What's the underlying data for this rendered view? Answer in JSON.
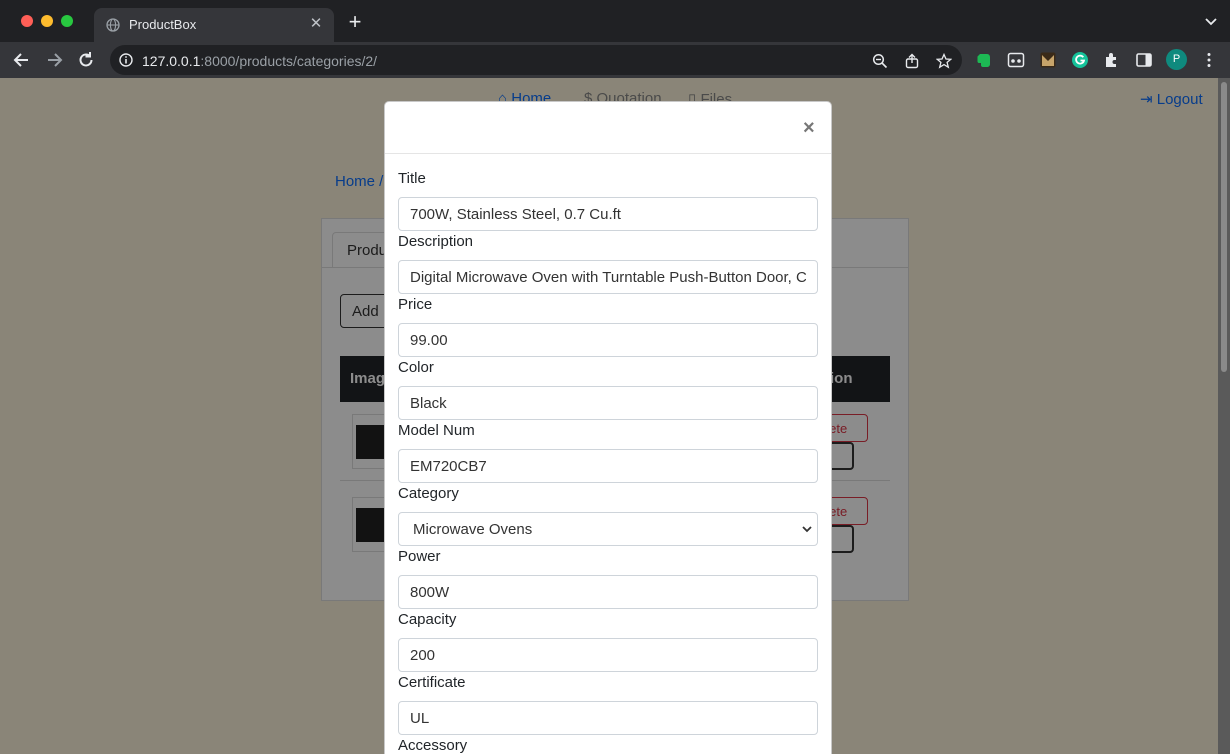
{
  "browser": {
    "tab_title": "ProductBox",
    "url_host": "127.0.0.1",
    "url_path": ":8000/products/categories/2/",
    "avatar_letter": "P"
  },
  "nav": {
    "home": "Home",
    "quotation": "Quotation",
    "files": "Files",
    "logout": "Logout"
  },
  "background": {
    "breadcrumb": "Home /",
    "tab_label": "Produ",
    "add_button": "Add I",
    "table_header_image": "Imag",
    "table_header_action": "tion",
    "delete_label": "elete",
    "edit_label": "dit"
  },
  "modal": {
    "close": "×",
    "fields": {
      "title": {
        "label": "Title",
        "value": "700W, Stainless Steel, 0.7 Cu.ft"
      },
      "description": {
        "label": "Description",
        "value": "Digital Microwave Oven with Turntable Push-Button Door, Child Safety Lock"
      },
      "price": {
        "label": "Price",
        "value": "99.00"
      },
      "color": {
        "label": "Color",
        "value": "Black"
      },
      "model_num": {
        "label": "Model Num",
        "value": "EM720CB7"
      },
      "category": {
        "label": "Category",
        "value": "Microwave Ovens"
      },
      "power": {
        "label": "Power",
        "value": "800W"
      },
      "capacity": {
        "label": "Capacity",
        "value": "200"
      },
      "certificate": {
        "label": "Certificate",
        "value": "UL"
      },
      "accessory": {
        "label": "Accessory"
      }
    }
  }
}
